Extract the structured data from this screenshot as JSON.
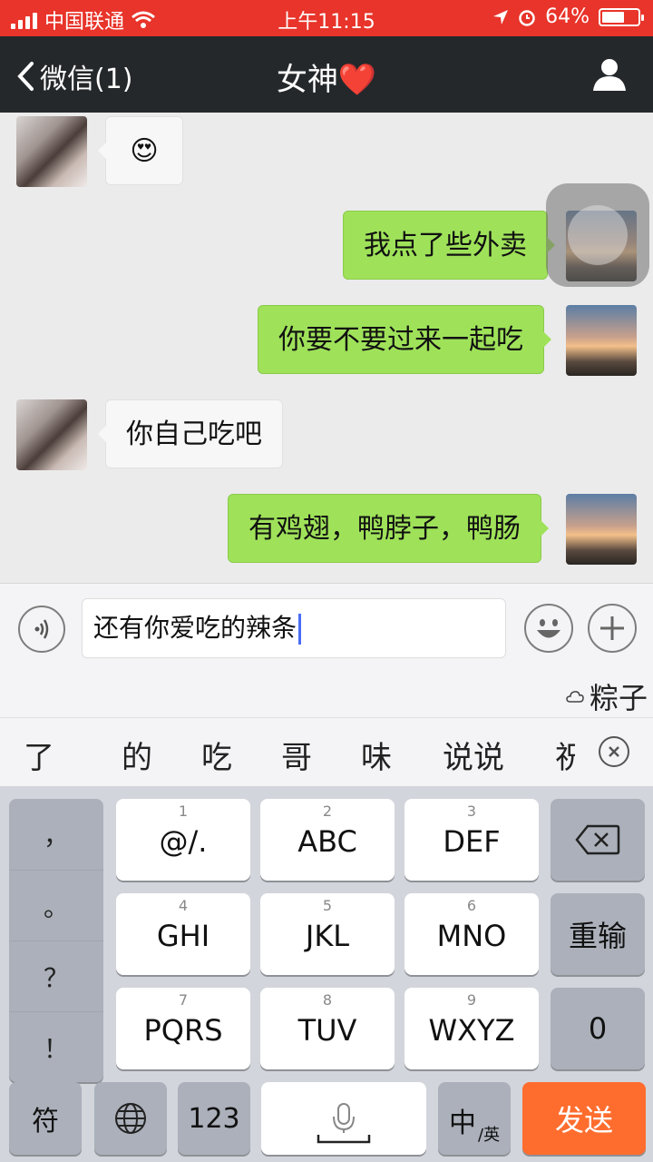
{
  "status_bar": {
    "carrier": "中国联通",
    "time": "上午11:15",
    "battery": "64%",
    "battery_level": 0.64
  },
  "nav": {
    "back_label": "微信(1)",
    "title": "女神",
    "title_emoji": "❤️"
  },
  "messages": [
    {
      "from": "her",
      "text": "😍"
    },
    {
      "from": "me",
      "text": "我点了些外卖"
    },
    {
      "from": "me",
      "text": "你要不要过来一起吃"
    },
    {
      "from": "her",
      "text": "你自己吃吧"
    },
    {
      "from": "me",
      "text": "有鸡翅，鸭脖子，鸭肠"
    }
  ],
  "input": {
    "value": "还有你爱吃的辣条"
  },
  "prediction": {
    "pinyin_word": "粽子"
  },
  "candidates": [
    "了",
    "的",
    "吃",
    "哥",
    "味",
    "说说",
    "祝"
  ],
  "keyboard": {
    "punctuation": [
      "，",
      "。",
      "？",
      "！"
    ],
    "keys": [
      {
        "num": "1",
        "label": "@/."
      },
      {
        "num": "2",
        "label": "ABC"
      },
      {
        "num": "3",
        "label": "DEF"
      },
      {
        "num": "4",
        "label": "GHI"
      },
      {
        "num": "5",
        "label": "JKL"
      },
      {
        "num": "6",
        "label": "MNO"
      },
      {
        "num": "7",
        "label": "PQRS"
      },
      {
        "num": "8",
        "label": "TUV"
      },
      {
        "num": "9",
        "label": "WXYZ"
      }
    ],
    "retype": "重输",
    "zero": "0",
    "symbols": "符",
    "num_mode": "123",
    "lang_main": "中",
    "lang_sub": "/英",
    "send": "发送"
  }
}
